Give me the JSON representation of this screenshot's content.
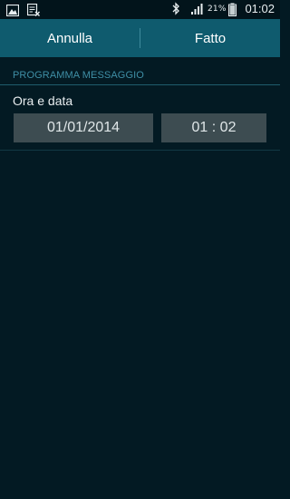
{
  "status_bar": {
    "icons_left": [
      "image-icon",
      "note-icon"
    ],
    "icons_right": [
      "bluetooth-icon",
      "signal-icon",
      "battery-icon"
    ],
    "battery_percent": "21%",
    "time": "01:02"
  },
  "action_bar": {
    "cancel_label": "Annulla",
    "done_label": "Fatto"
  },
  "section": {
    "title": "PROGRAMMA MESSAGGIO"
  },
  "schedule": {
    "label": "Ora e data",
    "date_value": "01/01/2014",
    "time_value": "01 : 02"
  },
  "colors": {
    "background": "#031a23",
    "action_bar": "#0f5b6e",
    "section_title": "#3f8fa6",
    "picker_bg": "#3d4c51"
  }
}
